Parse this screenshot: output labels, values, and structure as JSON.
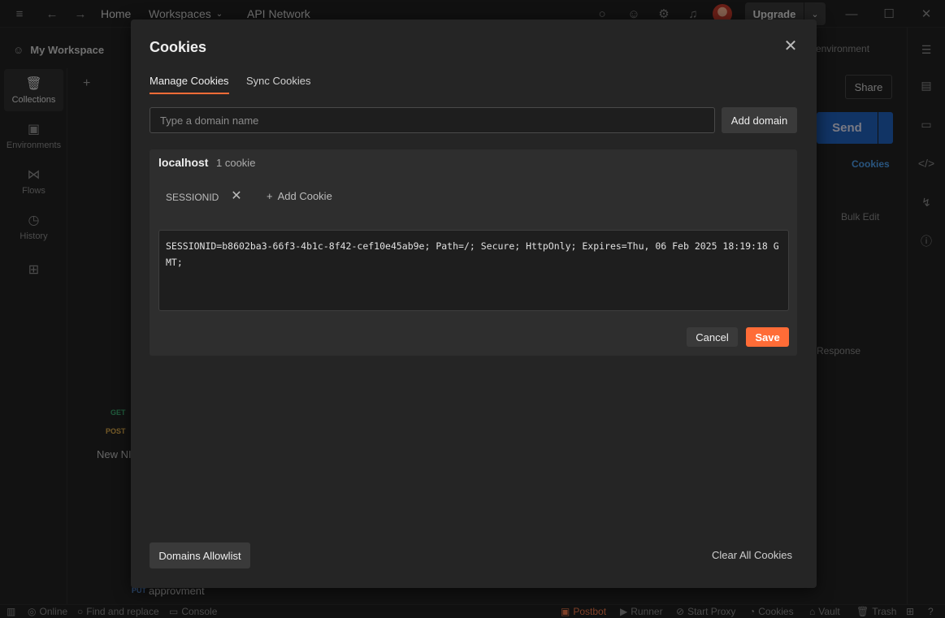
{
  "titlebar": {
    "home": "Home",
    "workspaces": "Workspaces",
    "api_network": "API Network",
    "upgrade": "Upgrade"
  },
  "workspace": {
    "name": "My Workspace"
  },
  "rail": {
    "collections": "Collections",
    "environments": "Environments",
    "flows": "Flows",
    "history": "History"
  },
  "tree": {
    "get_method": "GET",
    "post_method": "POST",
    "collection_name": "New NI",
    "put_method": "PUT",
    "put_request": "approvment"
  },
  "background": {
    "environment": "environment",
    "share": "Share",
    "send": "Send",
    "cookies": "Cookies",
    "bulk_edit": "Bulk Edit",
    "response": "Response"
  },
  "modal": {
    "title": "Cookies",
    "tabs": [
      {
        "label": "Manage Cookies",
        "active": true
      },
      {
        "label": "Sync Cookies",
        "active": false
      }
    ],
    "domain_placeholder": "Type a domain name",
    "add_domain": "Add domain",
    "domain": {
      "name": "localhost",
      "count": "1 cookie",
      "cookie_name": "SESSIONID",
      "add_cookie": "Add Cookie",
      "cookie_value": "SESSIONID=b8602ba3-66f3-4b1c-8f42-cef10e45ab9e; Path=/; Secure; HttpOnly; Expires=Thu, 06 Feb 2025 18:19:18 GMT;"
    },
    "cancel": "Cancel",
    "save": "Save",
    "domains_allowlist": "Domains Allowlist",
    "clear_all": "Clear All Cookies"
  },
  "statusbar": {
    "online": "Online",
    "find_replace": "Find and replace",
    "console": "Console",
    "postbot": "Postbot",
    "runner": "Runner",
    "start_proxy": "Start Proxy",
    "cookies": "Cookies",
    "vault": "Vault",
    "trash": "Trash"
  },
  "colors": {
    "accent": "#ff6c37",
    "send": "#1f5fb8",
    "link": "#4c9be8"
  }
}
